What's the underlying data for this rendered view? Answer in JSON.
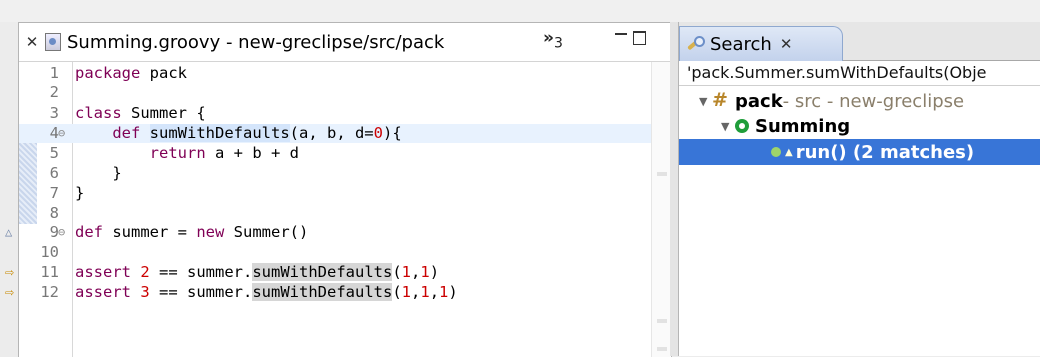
{
  "editor": {
    "tab_title": "Summing.groovy - new-greclipse/src/pack",
    "overflow_label": "»",
    "overflow_count": "3",
    "lines": [
      {
        "n": "1",
        "code": "package pack"
      },
      {
        "n": "2",
        "code": ""
      },
      {
        "n": "3",
        "code": "class Summer {"
      },
      {
        "n": "4",
        "code": "    def sumWithDefaults(a, b, d=0){"
      },
      {
        "n": "5",
        "code": "        return a + b + d"
      },
      {
        "n": "6",
        "code": "    }"
      },
      {
        "n": "7",
        "code": "}"
      },
      {
        "n": "8",
        "code": ""
      },
      {
        "n": "9",
        "code": "def summer = new Summer()"
      },
      {
        "n": "10",
        "code": ""
      },
      {
        "n": "11",
        "code": "assert 2 == summer.sumWithDefaults(1,1)"
      },
      {
        "n": "12",
        "code": "assert 3 == summer.sumWithDefaults(1,1,1)"
      }
    ]
  },
  "search": {
    "tab_label": "Search",
    "query": "'pack.Summer.sumWithDefaults(Obje",
    "tree": {
      "pkg_name": "pack",
      "pkg_detail": " - src - new-greclipse",
      "class_name": "Summing",
      "method_label": "run() (2 matches)"
    }
  },
  "colors": {
    "selection": "#3875d7",
    "keyword": "#7f0055",
    "number": "#cc0000"
  }
}
